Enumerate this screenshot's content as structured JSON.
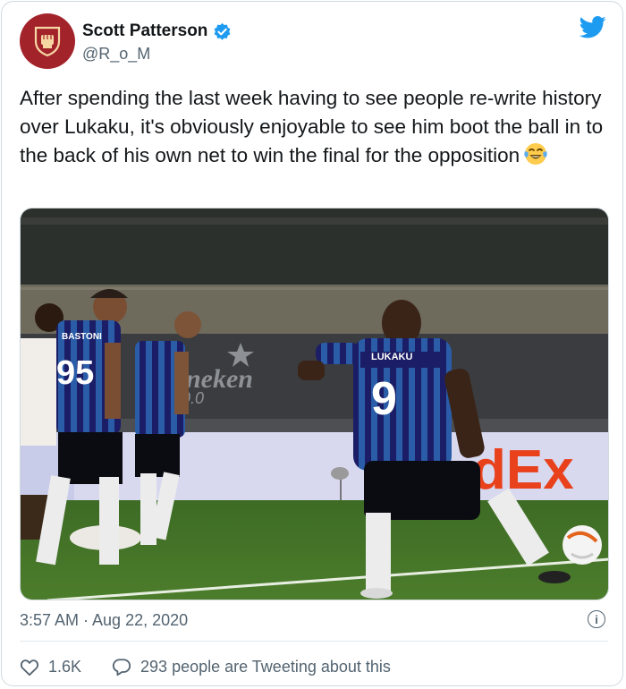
{
  "tweet": {
    "author_name": "Scott Patterson",
    "author_handle": "@R_o_M",
    "verified": true,
    "text": "After spending the last week having to see people re-write history over Lukaku, it's obviously enjoyable to see him boot the ball in to the back of his own net to win the final for the opposition",
    "text_emoji": "tears-of-joy",
    "timestamp": "3:57 AM · Aug 22, 2020",
    "likes": "1.6K",
    "replies_text": "293 people are Tweeting about this"
  },
  "photo": {
    "jersey_numbers": [
      "95",
      "9"
    ],
    "jersey_names": [
      "BASTONI",
      "LUKAKU"
    ],
    "board_text_1": "Heineken",
    "board_text_2": "0.0",
    "board_text_3": "dEx"
  },
  "colors": {
    "twitter_blue": "#1d9bf0",
    "avatar_red": "#a3232b",
    "secondary_text": "#536471"
  }
}
